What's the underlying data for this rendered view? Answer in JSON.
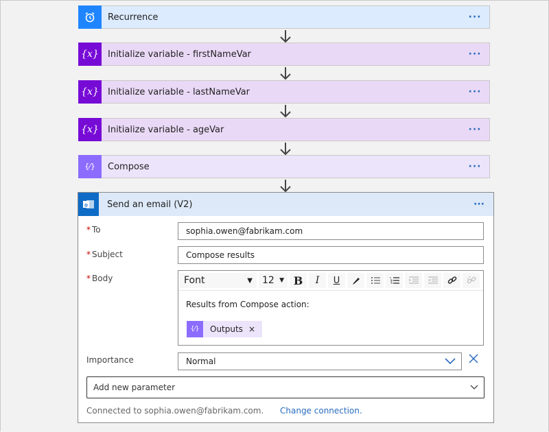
{
  "flow": {
    "steps": [
      {
        "title": "Recurrence",
        "icon": "alarm-clock-icon",
        "more": "···"
      },
      {
        "title": "Initialize variable - firstNameVar",
        "icon": "variable-icon",
        "icon_glyph": "{x}",
        "more": "···"
      },
      {
        "title": "Initialize variable - lastNameVar",
        "icon": "variable-icon",
        "icon_glyph": "{x}",
        "more": "···"
      },
      {
        "title": "Initialize variable - ageVar",
        "icon": "variable-icon",
        "icon_glyph": "{x}",
        "more": "···"
      },
      {
        "title": "Compose",
        "icon": "compose-icon",
        "icon_glyph": "{⁄}",
        "more": "···"
      }
    ],
    "colors": {
      "recurrence": "#1f85ff",
      "variable": "#770bd6",
      "compose": "#8c6cff",
      "outlook": "#0f6cc6",
      "link": "#2a6cbf",
      "required": "#cc0000"
    }
  },
  "email": {
    "title": "Send an email (V2)",
    "more": "···",
    "required_mark": "*",
    "fields": {
      "to": {
        "label": "To",
        "value": "sophia.owen@fabrikam.com"
      },
      "subject": {
        "label": "Subject",
        "value": "Compose results"
      },
      "body": {
        "label": "Body",
        "toolbar": {
          "font": "Font",
          "size": "12",
          "bold": "B",
          "italic": "I",
          "underline": "U"
        },
        "text": "Results from Compose action:",
        "token": {
          "label": "Outputs",
          "remove": "×",
          "glyph": "{⁄}"
        }
      },
      "importance": {
        "label": "Importance",
        "value": "Normal"
      }
    },
    "add_parameter": "Add new parameter",
    "connected_text": "Connected to sophia.owen@fabrikam.com.",
    "change_connection": "Change connection."
  }
}
